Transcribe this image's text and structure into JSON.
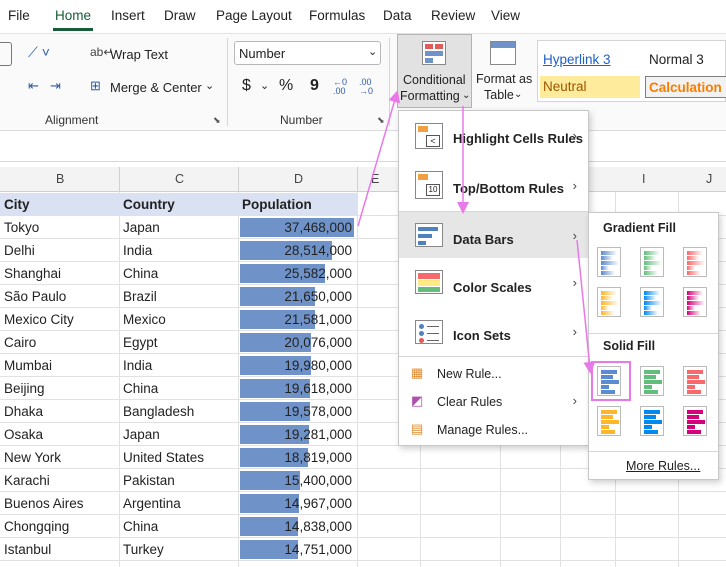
{
  "tabs": [
    "File",
    "Home",
    "Insert",
    "Draw",
    "Page Layout",
    "Formulas",
    "Data",
    "Review",
    "View"
  ],
  "ribbon": {
    "wrap_text": "Wrap Text",
    "merge_center": "Merge & Center",
    "alignment_group": "Alignment",
    "number_format": "Number",
    "number_group": "Number",
    "currency_symbol": "$",
    "percent_symbol": "%",
    "comma_symbol": "9",
    "conditional_formatting": [
      "Conditional",
      "Formatting"
    ],
    "format_as_table": [
      "Format as",
      "Table"
    ],
    "styles": {
      "hyperlink": "Hyperlink 3",
      "normal": "Normal 3",
      "neutral": "Neutral",
      "calculation": "Calculation"
    }
  },
  "columns": [
    "B",
    "C",
    "D",
    "E",
    "I",
    "J"
  ],
  "headers": [
    "City",
    "Country",
    "Population"
  ],
  "rows": [
    [
      "Tokyo",
      "Japan",
      "37,468,000",
      37468000
    ],
    [
      "Delhi",
      "India",
      "28,514,000",
      28514000
    ],
    [
      "Shanghai",
      "China",
      "25,582,000",
      25582000
    ],
    [
      "São Paulo",
      "Brazil",
      "21,650,000",
      21650000
    ],
    [
      "Mexico City",
      "Mexico",
      "21,581,000",
      21581000
    ],
    [
      "Cairo",
      "Egypt",
      "20,076,000",
      20076000
    ],
    [
      "Mumbai",
      "India",
      "19,980,000",
      19980000
    ],
    [
      "Beijing",
      "China",
      "19,618,000",
      19618000
    ],
    [
      "Dhaka",
      "Bangladesh",
      "19,578,000",
      19578000
    ],
    [
      "Osaka",
      "Japan",
      "19,281,000",
      19281000
    ],
    [
      "New York",
      "United States",
      "18,819,000",
      18819000
    ],
    [
      "Karachi",
      "Pakistan",
      "15,400,000",
      15400000
    ],
    [
      "Buenos Aires",
      "Argentina",
      "14,967,000",
      14967000
    ],
    [
      "Chongqing",
      "China",
      "14,838,000",
      14838000
    ],
    [
      "Istanbul",
      "Turkey",
      "14,751,000",
      14751000
    ]
  ],
  "cf_menu": {
    "highlight": "Highlight Cells Rules",
    "topbottom": "Top/Bottom Rules",
    "databars": "Data Bars",
    "colorscales": "Color Scales",
    "iconsets": "Icon Sets",
    "newrule": "New Rule...",
    "clearrules": "Clear Rules",
    "managerules": "Manage Rules..."
  },
  "databars_menu": {
    "gradient": "Gradient Fill",
    "solid": "Solid Fill",
    "more": "More Rules...",
    "colors": [
      "#5b8bd0",
      "#63be7b",
      "#f8696b",
      "#ffb628",
      "#008aef",
      "#d6007b"
    ]
  }
}
